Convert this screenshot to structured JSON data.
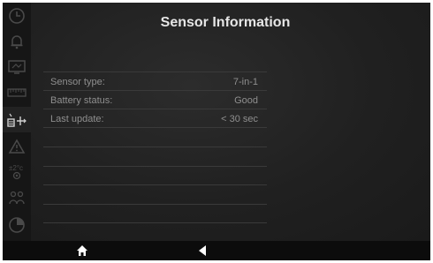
{
  "screen": {
    "title": "Sensor Information"
  },
  "sidebar": {
    "items": [
      {
        "icon": "clock-icon"
      },
      {
        "icon": "bell-icon"
      },
      {
        "icon": "display-icon"
      },
      {
        "icon": "ruler-icon"
      },
      {
        "icon": "sensor-icon",
        "active": true
      },
      {
        "icon": "warning-icon"
      },
      {
        "icon": "temperature-offset-icon"
      },
      {
        "icon": "people-icon"
      },
      {
        "icon": "pie-chart-icon"
      }
    ]
  },
  "sensor_info": {
    "rows": [
      {
        "label": "Sensor type:",
        "value": "7-in-1"
      },
      {
        "label": "Battery status:",
        "value": "Good"
      },
      {
        "label": "Last update:",
        "value": "< 30 sec"
      },
      {
        "label": "",
        "value": ""
      },
      {
        "label": "",
        "value": ""
      },
      {
        "label": "",
        "value": ""
      },
      {
        "label": "",
        "value": ""
      },
      {
        "label": "",
        "value": ""
      }
    ]
  },
  "bottom_bar": {
    "home_icon": "home-icon",
    "back_icon": "back-arrow-icon"
  },
  "colors": {
    "background": "#1d1d1d",
    "text": "#8f8f8f",
    "title": "#e6e6e6",
    "divider": "#3a3a3a"
  }
}
